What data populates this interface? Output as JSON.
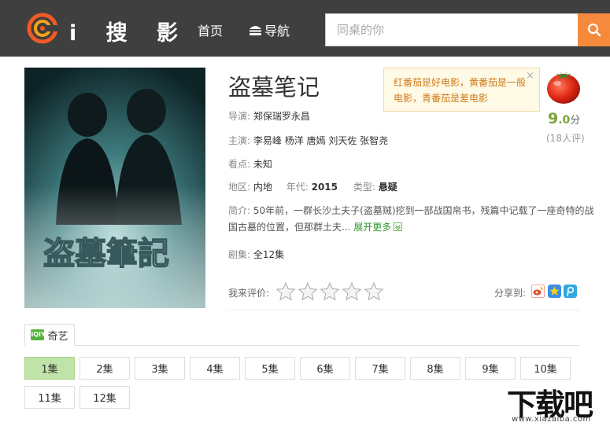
{
  "header": {
    "brand": "i 搜 影",
    "nav_home": "首页",
    "nav_guide": "导航",
    "search_placeholder": "同桌的你"
  },
  "movie": {
    "title": "盗墓笔记",
    "director_label": "导演:",
    "director": "郑保瑞罗永昌",
    "cast_label": "主演:",
    "cast": "李易峰 杨洋 唐嫣 刘天佐 张智尧",
    "highlight_label": "看点:",
    "highlight": "未知",
    "region_label": "地区:",
    "region": "内地",
    "year_label": "年代:",
    "year": "2015",
    "genre_label": "类型:",
    "genre": "悬疑",
    "summary_label": "简介:",
    "summary": "50年前，一群长沙土夫子(盗墓贼)挖到一部战国帛书，残篇中记载了一座奇特的战国古墓的位置，但那群土夫...",
    "expand": "展开更多",
    "episodes_label": "剧集:",
    "episodes_total": "全12集"
  },
  "tooltip": {
    "text": "红番茄是好电影，黄番茄是一般电影，青番茄是差电影",
    "close": "×"
  },
  "score": {
    "main": "9",
    "decimal": ".0",
    "unit": "分",
    "raters": "(18人评)"
  },
  "rating": {
    "label": "我来评价:",
    "stars": 0,
    "max": 5
  },
  "share": {
    "label": "分享到:",
    "targets": [
      "weibo",
      "qzone",
      "tencent-weibo"
    ]
  },
  "source_tab": {
    "label": "奇艺",
    "icon_text": "iQIYI"
  },
  "episodes": [
    "1集",
    "2集",
    "3集",
    "4集",
    "5集",
    "6集",
    "7集",
    "8集",
    "9集",
    "10集",
    "11集",
    "12集"
  ],
  "active_episode": 0,
  "poster": {
    "title_text": "盗墓筆記"
  },
  "watermark": {
    "text": "下载吧",
    "sub": "www.xiazaiba.com"
  },
  "colors": {
    "header_bg": "#3f3f3f",
    "accent": "#f58a3d",
    "active_episode": "#bfe3a8",
    "score": "#7aa53a"
  }
}
